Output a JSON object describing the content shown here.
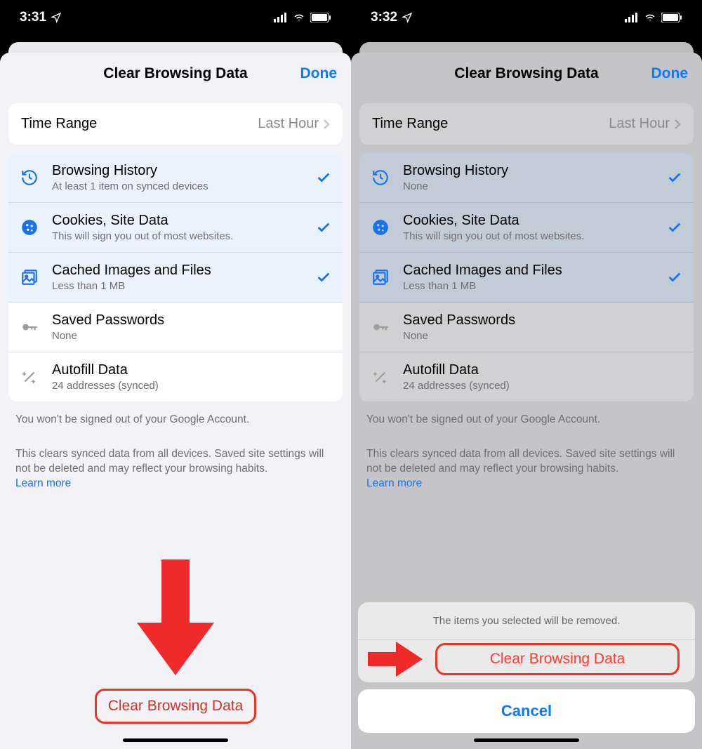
{
  "left": {
    "status_time": "3:31",
    "nav_title": "Clear Browsing Data",
    "nav_done": "Done",
    "time_range_label": "Time Range",
    "time_range_value": "Last Hour",
    "items": [
      {
        "title": "Browsing History",
        "sub": "At least 1 item on synced devices",
        "selected": true,
        "icon": "history"
      },
      {
        "title": "Cookies, Site Data",
        "sub": "This will sign you out of most websites.",
        "selected": true,
        "icon": "cookie"
      },
      {
        "title": "Cached Images and Files",
        "sub": "Less than 1 MB",
        "selected": true,
        "icon": "image"
      },
      {
        "title": "Saved Passwords",
        "sub": "None",
        "selected": false,
        "icon": "key"
      },
      {
        "title": "Autofill Data",
        "sub": "24 addresses (synced)",
        "selected": false,
        "icon": "wand"
      }
    ],
    "info1": "You won't be signed out of your Google Account.",
    "info2": "This clears synced data from all devices. Saved site settings will not be deleted and may reflect your browsing habits.",
    "learn_more": "Learn more",
    "clear_button": "Clear Browsing Data"
  },
  "right": {
    "status_time": "3:32",
    "nav_title": "Clear Browsing Data",
    "nav_done": "Done",
    "time_range_label": "Time Range",
    "time_range_value": "Last Hour",
    "items": [
      {
        "title": "Browsing History",
        "sub": "None",
        "selected": true,
        "icon": "history"
      },
      {
        "title": "Cookies, Site Data",
        "sub": "This will sign you out of most websites.",
        "selected": true,
        "icon": "cookie"
      },
      {
        "title": "Cached Images and Files",
        "sub": "Less than 1 MB",
        "selected": true,
        "icon": "image"
      },
      {
        "title": "Saved Passwords",
        "sub": "None",
        "selected": false,
        "icon": "key"
      },
      {
        "title": "Autofill Data",
        "sub": "24 addresses (synced)",
        "selected": false,
        "icon": "wand"
      }
    ],
    "info1": "You won't be signed out of your Google Account.",
    "info2": "This clears synced data from all devices. Saved site settings will not be deleted and may reflect your browsing habits.",
    "learn_more": "Learn more",
    "action_message": "The items you selected will be removed.",
    "action_destructive": "Clear Browsing Data",
    "action_cancel": "Cancel"
  }
}
